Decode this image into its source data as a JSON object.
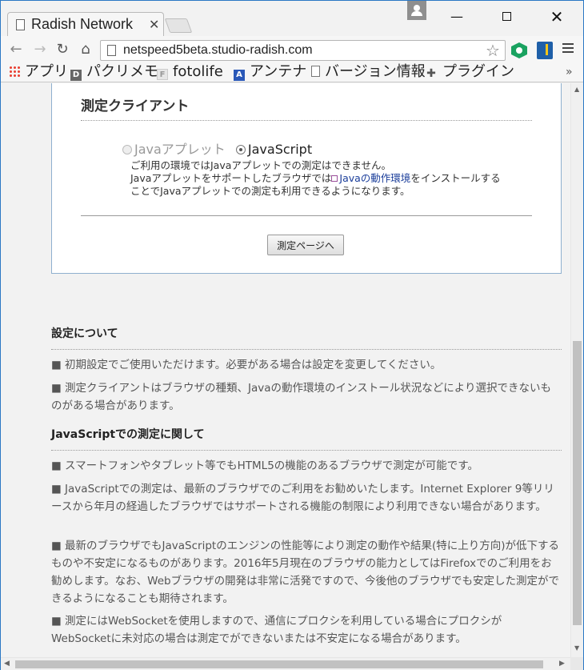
{
  "browser": {
    "tab_title": "Radish Network",
    "url": "netspeed5beta.studio-radish.com",
    "bookmarks": [
      {
        "label": "アプリ",
        "icon": "apps-grid-icon"
      },
      {
        "label": "パクリメモ",
        "icon": "d-favicon"
      },
      {
        "label": "fotolife",
        "icon": "f-favicon"
      },
      {
        "label": "アンテナ",
        "icon": "a-favicon"
      },
      {
        "label": "バージョン情報",
        "icon": "page-icon"
      },
      {
        "label": "プラグイン",
        "icon": "puzzle-icon"
      }
    ],
    "bookmarks_more": "»",
    "colors": {
      "frame": "#2b78c5",
      "link": "#1a3d9a",
      "panel_border": "#8fb0cf"
    }
  },
  "client_panel": {
    "title": "測定クライアント",
    "option_java": "Javaアプレット",
    "option_js": "JavaScript",
    "selected": "JavaScript",
    "note_line1": "ご利用の環境ではJavaアプレットでの測定はできません。",
    "note_line2_pre": "Javaアプレットをサポートしたブラウザでは",
    "note_link": "Javaの動作環境",
    "note_line2_post": "をインストールする",
    "note_line3": "ことでJavaアプレットでの測定も利用できるようになります。",
    "start_button": "測定ページへ"
  },
  "settings": {
    "title": "設定について",
    "items": [
      "■ 初期設定でご使用いただけます。必要がある場合は設定を変更してください。",
      "■ 測定クライアントはブラウザの種類、Javaの動作環境のインストール状況などにより選択できないものがある場合があります。"
    ]
  },
  "javascript": {
    "title": "JavaScriptでの測定に関して",
    "items": [
      "■ スマートフォンやタブレット等でもHTML5の機能のあるブラウザで測定が可能です。",
      "■ JavaScriptでの測定は、最新のブラウザでのご利用をお勧めいたします。Internet Explorer 9等リリースから年月の経過したブラウザではサポートされる機能の制限により利用できない場合があります。",
      "■ 最新のブラウザでもJavaScriptのエンジンの性能等により測定の動作や結果(特に上り方向)が低下するものや不安定になるものがあります。2016年5月現在のブラウザの能力としてはFirefoxでのご利用をお勧めします。なお、Webブラウザの開発は非常に活発ですので、今後他のブラウザでも安定した測定ができるようになることも期待されます。",
      "■ 測定にはWebSocketを使用しますので、通信にプロクシを利用している場合にプロクシがWebSocketに未対応の場合は測定でができないまたは不安定になる場合があります。"
    ]
  }
}
